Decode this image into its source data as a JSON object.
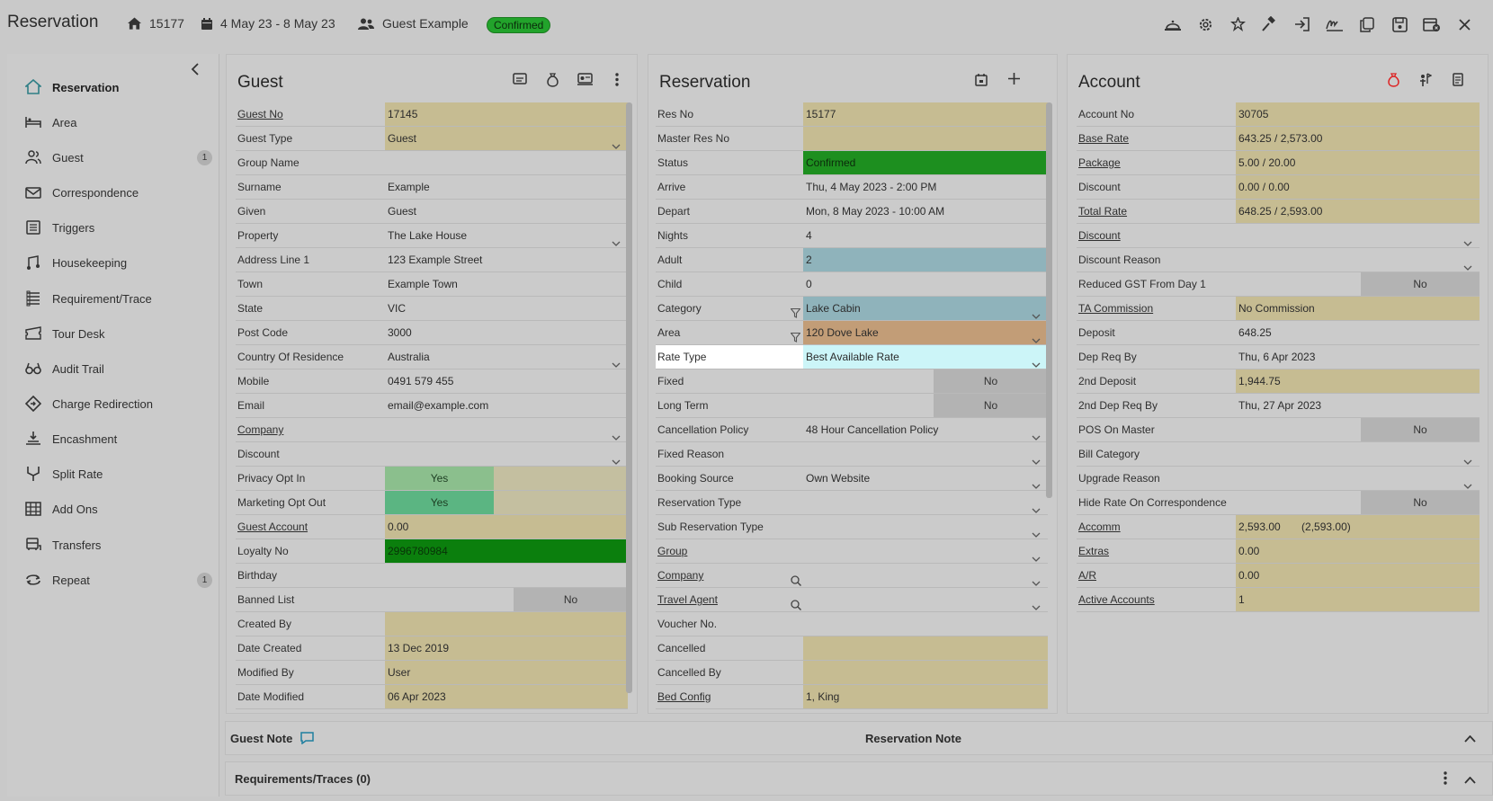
{
  "header": {
    "title": "Reservation",
    "res_no": "15177",
    "dates": "4 May 23  -  8 May 23",
    "guest": "Guest Example",
    "status": "Confirmed"
  },
  "top_icons": [
    "housekeeping-bell-icon",
    "settings-gear-icon",
    "magic-wand-icon",
    "gavel-icon",
    "sign-in-icon",
    "signature-icon",
    "copy-icon",
    "save-icon",
    "calendar-cancel-icon",
    "close-icon"
  ],
  "sidebar": {
    "items": [
      {
        "label": "Reservation",
        "icon": "home-icon"
      },
      {
        "label": "Area",
        "icon": "bed-icon"
      },
      {
        "label": "Guest",
        "icon": "users-icon",
        "badge": "1"
      },
      {
        "label": "Correspondence",
        "icon": "mail-icon"
      },
      {
        "label": "Triggers",
        "icon": "triggers-icon"
      },
      {
        "label": "Housekeeping",
        "icon": "housekeeping-icon"
      },
      {
        "label": "Requirement/Trace",
        "icon": "list-icon"
      },
      {
        "label": "Tour Desk",
        "icon": "ticket-icon"
      },
      {
        "label": "Audit Trail",
        "icon": "glasses-icon"
      },
      {
        "label": "Charge Redirection",
        "icon": "redirect-icon"
      },
      {
        "label": "Encashment",
        "icon": "encash-icon"
      },
      {
        "label": "Split Rate",
        "icon": "split-icon"
      },
      {
        "label": "Add Ons",
        "icon": "addons-icon"
      },
      {
        "label": "Transfers",
        "icon": "bus-icon"
      },
      {
        "label": "Repeat",
        "icon": "repeat-icon",
        "badge": "1"
      }
    ]
  },
  "guest_panel": {
    "title": "Guest",
    "rows": [
      {
        "label": "Guest No",
        "value": "17145",
        "link": true,
        "style": "yellow"
      },
      {
        "label": "Guest Type",
        "value": "Guest",
        "style": "yellow",
        "dropdown": true
      },
      {
        "label": "Group Name",
        "value": ""
      },
      {
        "label": "Surname",
        "value": "Example"
      },
      {
        "label": "Given",
        "value": "Guest"
      },
      {
        "label": "Property",
        "value": "The Lake House",
        "dropdown": true
      },
      {
        "label": "Address Line 1",
        "value": "123 Example Street"
      },
      {
        "label": "Town",
        "value": "Example Town"
      },
      {
        "label": "State",
        "value": "VIC"
      },
      {
        "label": "Post Code",
        "value": "3000"
      },
      {
        "label": "Country Of Residence",
        "value": "Australia",
        "dropdown": true
      },
      {
        "label": "Mobile",
        "value": "0491 579 455"
      },
      {
        "label": "Email",
        "value": "email@example.com"
      },
      {
        "label": "Company",
        "value": "",
        "link": true,
        "dropdown": true
      },
      {
        "label": "Discount",
        "value": "",
        "dropdown": true
      },
      {
        "label": "Privacy Opt In",
        "value": "",
        "toggle": "Yes",
        "toggle_style": "light"
      },
      {
        "label": "Marketing Opt Out",
        "value": "",
        "toggle": "Yes",
        "toggle_style": "green"
      },
      {
        "label": "Guest Account",
        "value": "0.00",
        "link": true,
        "style": "yellow"
      },
      {
        "label": "Loyalty No",
        "value": "2996780984",
        "style": "dkgreen"
      },
      {
        "label": "Birthday",
        "value": ""
      },
      {
        "label": "Banned List",
        "value": "",
        "toggle_no": "No"
      },
      {
        "label": "Created By",
        "value": "",
        "style": "yellow"
      },
      {
        "label": "Date Created",
        "value": "13 Dec 2019",
        "style": "yellow"
      },
      {
        "label": "Modified By",
        "value": "User",
        "style": "yellow"
      },
      {
        "label": "Date Modified",
        "value": "06 Apr 2023",
        "style": "yellow"
      }
    ]
  },
  "reservation_panel": {
    "title": "Reservation",
    "rows": [
      {
        "label": "Res No",
        "value": "15177",
        "style": "yellow"
      },
      {
        "label": "Master Res No",
        "value": "",
        "style": "yellow"
      },
      {
        "label": "Status",
        "value": "Confirmed",
        "style": "green"
      },
      {
        "label": "Arrive",
        "value": "Thu, 4 May 2023 - 2:00 PM"
      },
      {
        "label": "Depart",
        "value": "Mon, 8 May 2023 - 10:00 AM"
      },
      {
        "label": "Nights",
        "value": "4"
      },
      {
        "label": "Adult",
        "value": "2",
        "style": "blue"
      },
      {
        "label": "Child",
        "value": "0"
      },
      {
        "label": "Category",
        "value": "Lake Cabin",
        "style": "blue",
        "dropdown": true,
        "filter": true
      },
      {
        "label": "Area",
        "value": "120 Dove Lake",
        "style": "tan",
        "dropdown": true,
        "filter": true
      },
      {
        "label": "Rate Type",
        "value": "Best Available Rate",
        "style": "cyan",
        "dropdown": true,
        "highlight": true
      },
      {
        "label": "Fixed",
        "value": "",
        "toggle_no": "No"
      },
      {
        "label": "Long Term",
        "value": "",
        "toggle_no": "No"
      },
      {
        "label": "Cancellation Policy",
        "value": "48 Hour Cancellation Policy",
        "dropdown": true
      },
      {
        "label": "Fixed Reason",
        "value": "",
        "dropdown": true
      },
      {
        "label": "Booking Source",
        "value": "Own Website",
        "dropdown": true
      },
      {
        "label": "Reservation Type",
        "value": "",
        "dropdown": true
      },
      {
        "label": "Sub Reservation Type",
        "value": "",
        "dropdown": true
      },
      {
        "label": "Group",
        "value": "",
        "link": true,
        "dropdown": true
      },
      {
        "label": "Company",
        "value": "",
        "link": true,
        "dropdown": true,
        "search": true
      },
      {
        "label": "Travel Agent",
        "value": "",
        "link": true,
        "dropdown": true,
        "search": true
      },
      {
        "label": "Voucher No.",
        "value": ""
      },
      {
        "label": "Cancelled",
        "value": "",
        "style": "yellow"
      },
      {
        "label": "Cancelled By",
        "value": "",
        "style": "yellow"
      },
      {
        "label": "Bed Config",
        "value": "1, King",
        "link": true,
        "style": "yellow"
      }
    ]
  },
  "account_panel": {
    "title": "Account",
    "rows": [
      {
        "label": "Account No",
        "value": "30705",
        "style": "yellow"
      },
      {
        "label": "Base Rate",
        "value": "643.25 / 2,573.00",
        "link": true,
        "style": "yellow"
      },
      {
        "label": "Package",
        "value": "5.00 / 20.00",
        "link": true,
        "style": "yellow"
      },
      {
        "label": "Discount",
        "value": "0.00 / 0.00",
        "style": "yellow"
      },
      {
        "label": "Total Rate",
        "value": "648.25 / 2,593.00",
        "link": true,
        "style": "yellow"
      },
      {
        "label": "Discount",
        "value": "",
        "link": true,
        "dropdown": true
      },
      {
        "label": "Discount Reason",
        "value": "",
        "dropdown": true
      },
      {
        "label": "Reduced GST From Day 1",
        "value": "",
        "toggle_no": "No"
      },
      {
        "label": "TA Commission",
        "value": "No Commission",
        "link": true,
        "style": "yellow"
      },
      {
        "label": "Deposit",
        "value": "648.25"
      },
      {
        "label": "Dep Req By",
        "value": "Thu, 6 Apr 2023"
      },
      {
        "label": "2nd Deposit",
        "value": "1,944.75",
        "style": "yellow"
      },
      {
        "label": "2nd Dep Req By",
        "value": "Thu, 27 Apr 2023"
      },
      {
        "label": "POS On Master",
        "value": "",
        "toggle_no": "No"
      },
      {
        "label": "Bill Category",
        "value": "",
        "dropdown": true
      },
      {
        "label": "Upgrade Reason",
        "value": "",
        "dropdown": true
      },
      {
        "label": "Hide Rate On Correspondence",
        "value": "",
        "toggle_no": "No"
      },
      {
        "label": "Accomm",
        "value": "2,593.00       (2,593.00)",
        "link": true,
        "style": "yellow"
      },
      {
        "label": "Extras",
        "value": "0.00",
        "link": true,
        "style": "yellow"
      },
      {
        "label": "A/R",
        "value": "0.00",
        "link": true,
        "style": "yellow"
      },
      {
        "label": "Active Accounts",
        "value": "1",
        "link": true,
        "style": "yellow"
      }
    ]
  },
  "notes": {
    "guest_note": "Guest Note",
    "reservation_note": "Reservation Note",
    "requirements": "Requirements/Traces (0)"
  }
}
